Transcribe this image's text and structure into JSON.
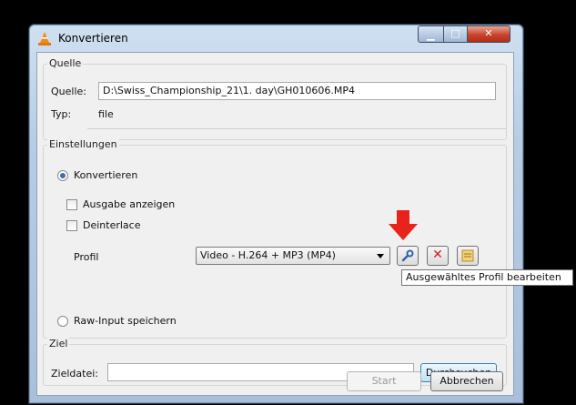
{
  "window": {
    "title": "Konvertieren"
  },
  "quelle": {
    "group_title": "Quelle",
    "source_label": "Quelle:",
    "source_value": "D:\\Swiss_Championship_21\\1. day\\GH010606.MP4",
    "type_label": "Typ:",
    "type_value": "file"
  },
  "einstellungen": {
    "group_title": "Einstellungen",
    "konvertieren_label": "Konvertieren",
    "ausgabe_label": "Ausgabe anzeigen",
    "deinterlace_label": "Deinterlace",
    "profil_label": "Profil",
    "profil_value": "Video - H.264 + MP3 (MP4)",
    "raw_label": "Raw-Input speichern"
  },
  "tooltip": {
    "text": "Ausgewähltes Profil bearbeiten"
  },
  "ziel": {
    "group_title": "Ziel",
    "zieldatei_label": "Zieldatei:",
    "zieldatei_value": "",
    "browse_label": "Durchsuchen"
  },
  "buttons": {
    "start_label": "Start",
    "cancel_label": "Abbrechen"
  },
  "icons": {
    "vlc": "traffic-cone-icon",
    "edit": "wrench-icon",
    "delete": "red-x-icon",
    "new": "new-profile-icon",
    "pointer": "red-arrow-icon"
  },
  "colors": {
    "accent_red": "#e8231a",
    "title_bar": "#b8cde4",
    "client_bg": "#f0f0f0"
  }
}
